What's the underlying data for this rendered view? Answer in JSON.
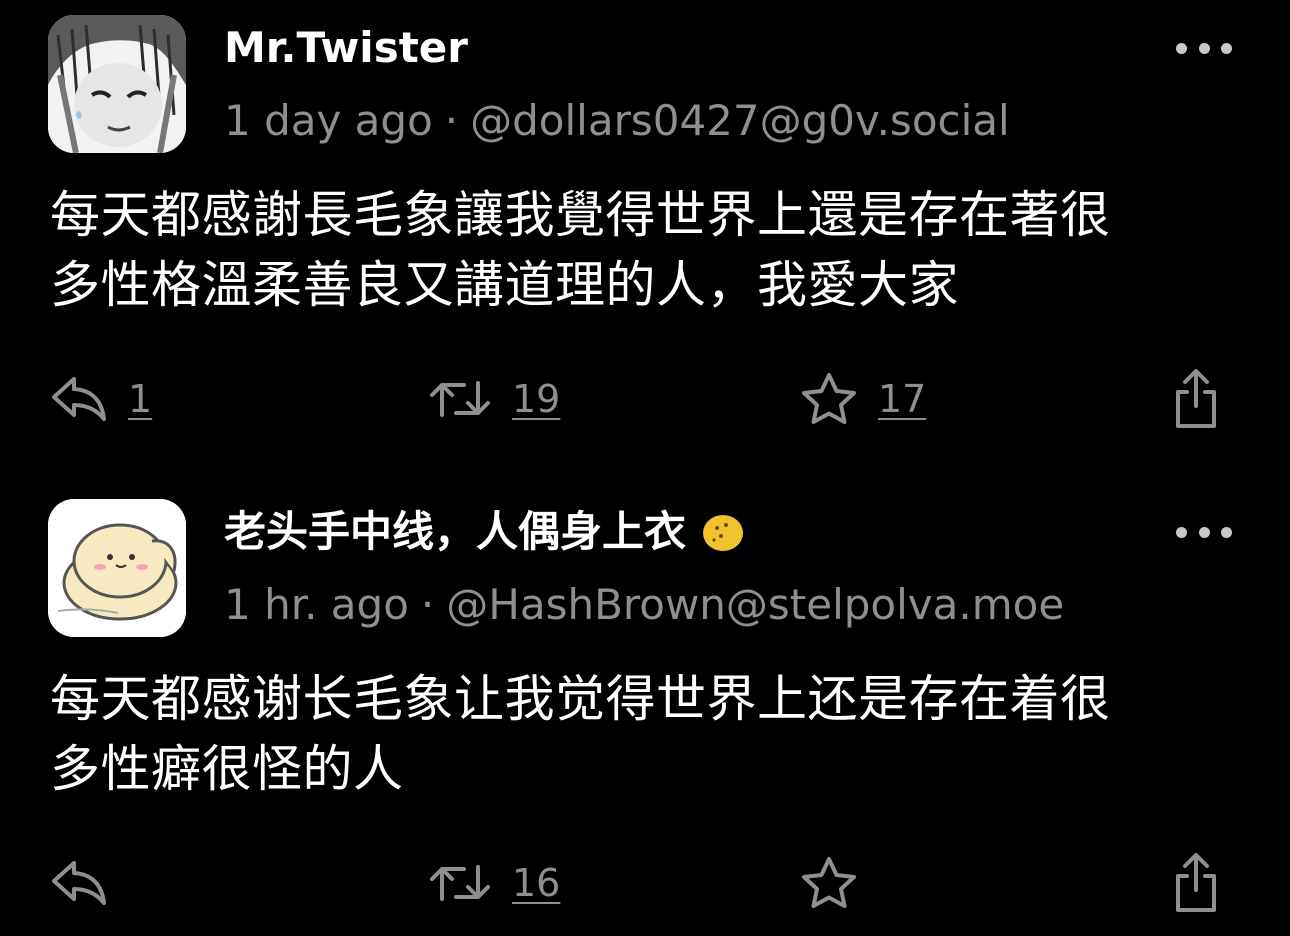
{
  "posts": [
    {
      "display_name": "Mr.Twister",
      "time": "1 day ago",
      "separator": "·",
      "handle": "@dollars0427@g0v.social",
      "content_lines": [
        "每天都感謝長毛象讓我覺得世界上還是存在著很",
        "多性格溫柔善良又講道理的人，我愛大家"
      ],
      "replies": "1",
      "boosts": "19",
      "favourites": "17"
    },
    {
      "display_name": "老头手中线，人偶身上衣",
      "time": "1 hr. ago",
      "separator": "·",
      "handle": "@HashBrown@stelpolva.moe",
      "content_lines": [
        "每天都感谢长毛象让我觉得世界上还是存在着很",
        "多性癖很怪的人"
      ],
      "replies": "",
      "boosts": "16",
      "favourites": ""
    }
  ],
  "icons": {
    "reply": "reply-icon",
    "boost": "boost-icon",
    "favourite": "star-icon",
    "share": "share-icon",
    "more": "ellipsis-icon"
  },
  "colors": {
    "background": "#000000",
    "text": "#ffffff",
    "secondary": "#8e8e93"
  }
}
